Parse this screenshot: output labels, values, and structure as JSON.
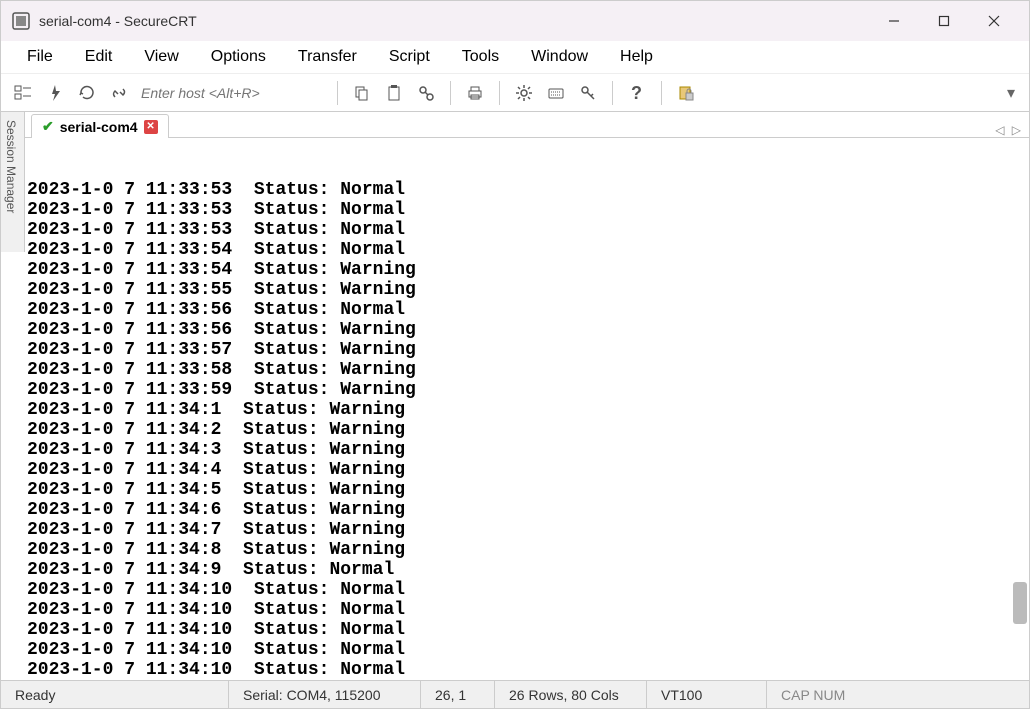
{
  "window": {
    "title": "serial-com4 - SecureCRT"
  },
  "menu": [
    "File",
    "Edit",
    "View",
    "Options",
    "Transfer",
    "Script",
    "Tools",
    "Window",
    "Help"
  ],
  "toolbar": {
    "host_placeholder": "Enter host <Alt+R>"
  },
  "sidebar": {
    "label": "Session Manager"
  },
  "tab": {
    "label": "serial-com4"
  },
  "terminal_lines": [
    "2023-1-0 7 11:33:53  Status: Normal",
    "2023-1-0 7 11:33:53  Status: Normal",
    "2023-1-0 7 11:33:53  Status: Normal",
    "2023-1-0 7 11:33:54  Status: Normal",
    "2023-1-0 7 11:33:54  Status: Warning",
    "2023-1-0 7 11:33:55  Status: Warning",
    "2023-1-0 7 11:33:56  Status: Normal",
    "2023-1-0 7 11:33:56  Status: Warning",
    "2023-1-0 7 11:33:57  Status: Warning",
    "2023-1-0 7 11:33:58  Status: Warning",
    "2023-1-0 7 11:33:59  Status: Warning",
    "2023-1-0 7 11:34:1  Status: Warning",
    "2023-1-0 7 11:34:2  Status: Warning",
    "2023-1-0 7 11:34:3  Status: Warning",
    "2023-1-0 7 11:34:4  Status: Warning",
    "2023-1-0 7 11:34:5  Status: Warning",
    "2023-1-0 7 11:34:6  Status: Warning",
    "2023-1-0 7 11:34:7  Status: Warning",
    "2023-1-0 7 11:34:8  Status: Warning",
    "2023-1-0 7 11:34:9  Status: Normal",
    "2023-1-0 7 11:34:10  Status: Normal",
    "2023-1-0 7 11:34:10  Status: Normal",
    "2023-1-0 7 11:34:10  Status: Normal",
    "2023-1-0 7 11:34:10  Status: Normal",
    "2023-1-0 7 11:34:10  Status: Normal"
  ],
  "status": {
    "ready": "Ready",
    "serial": "Serial: COM4, 115200",
    "pos": "26,   1",
    "dims": "26 Rows, 80 Cols",
    "vt": "VT100",
    "caps": "CAP NUM"
  }
}
